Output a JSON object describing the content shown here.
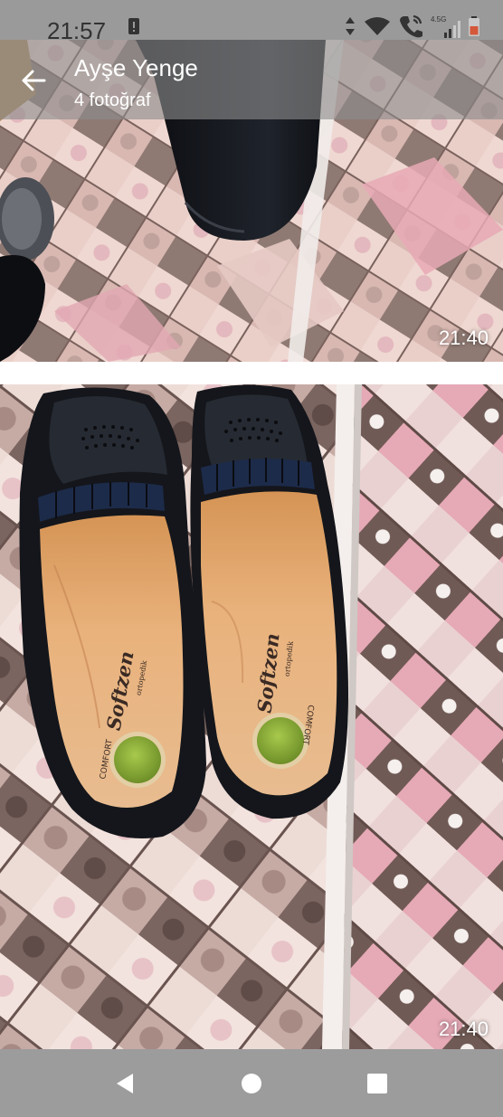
{
  "status_bar": {
    "time": "21:57",
    "network_label": "4.5G",
    "icons": [
      "notification-icon",
      "data-arrows-icon",
      "wifi-icon",
      "wifi-calling-icon",
      "cell-signal-icon",
      "battery-icon"
    ]
  },
  "app_bar": {
    "title": "Ayşe Yenge",
    "subtitle": "4 fotoğraf",
    "back_icon": "arrow-left-icon"
  },
  "photos": [
    {
      "time": "21:40",
      "content": "shoe-on-carpet-photo"
    },
    {
      "time": "21:40",
      "content": "pair-of-black-shoes-photo"
    }
  ],
  "insole": {
    "brand": "Softzen",
    "sub": "ortopedik",
    "label": "COMFORT"
  },
  "nav_bar": {
    "icons": [
      "nav-back-triangle-icon",
      "nav-home-circle-icon",
      "nav-recents-square-icon"
    ]
  },
  "colors": {
    "status_bar": "#9a9a9a",
    "nav_bar": "#9c9c9c",
    "shoe": "#15171c",
    "insole": "#e0a970",
    "gel_pad": "#8fb23a",
    "carpet_pink": "#e8b5bf",
    "carpet_brown": "#6d5650"
  }
}
